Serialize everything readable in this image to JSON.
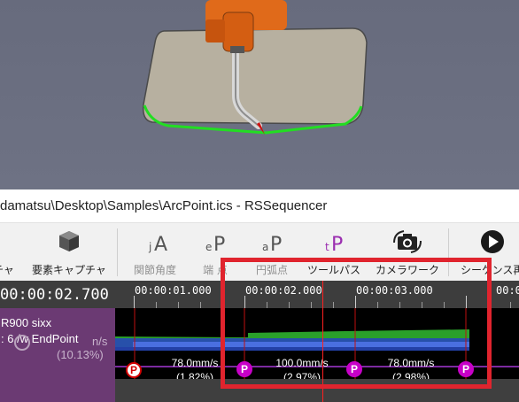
{
  "window": {
    "title": "damatsu\\Desktop\\Samples\\ArcPoint.ics - RSSequencer"
  },
  "toolbar": {
    "items": [
      {
        "label": "チャ",
        "icon": "capture-icon",
        "enabled": true
      },
      {
        "label": "要素キャプチャ",
        "icon": "element-capture-cube-icon",
        "enabled": true
      },
      {
        "label": "関節角度",
        "icon": "joint-angle-jA-icon",
        "icon_text": "jA",
        "enabled": false
      },
      {
        "label": "端 点",
        "icon": "end-point-eP-icon",
        "icon_text": "eP",
        "enabled": false
      },
      {
        "label": "円弧点",
        "icon": "arc-point-aP-icon",
        "icon_text": "aP",
        "enabled": false
      },
      {
        "label": "ツールパス",
        "icon": "tool-path-tP-icon",
        "icon_text": "tP",
        "enabled": true
      },
      {
        "label": "カメラワーク",
        "icon": "camera-work-icon",
        "enabled": true
      },
      {
        "label": "シーケンス再",
        "icon": "play-sequence-icon",
        "enabled": true
      }
    ]
  },
  "timeline": {
    "current_time": "00:00:02.700",
    "ticks": [
      "00:00:01.000",
      "00:00:02.000",
      "00:00:03.000",
      "00:0"
    ],
    "track": {
      "name": "R900 sixx",
      "subtitle": ": 6 /w EndPoint",
      "speed_partial": "n/s",
      "percent_partial": "(10.13%)"
    },
    "points": [
      {
        "type": "P",
        "style": "end-point"
      },
      {
        "type": "P",
        "style": "arc-point"
      },
      {
        "type": "P",
        "style": "arc-point"
      },
      {
        "type": "P",
        "style": "arc-point"
      }
    ],
    "segments": [
      {
        "speed": "78.0mm/s",
        "percent": "(1.82%)"
      },
      {
        "speed": "100.0mm/s",
        "percent": "(2.97%)"
      },
      {
        "speed": "78.0mm/s",
        "percent": "(2.98%)"
      }
    ]
  },
  "colors": {
    "highlight_box": "#e0242e",
    "path_green": "#22dd22",
    "point_magenta": "#c800c8",
    "playhead": "#ff2020",
    "track_header": "#6b3a73"
  }
}
